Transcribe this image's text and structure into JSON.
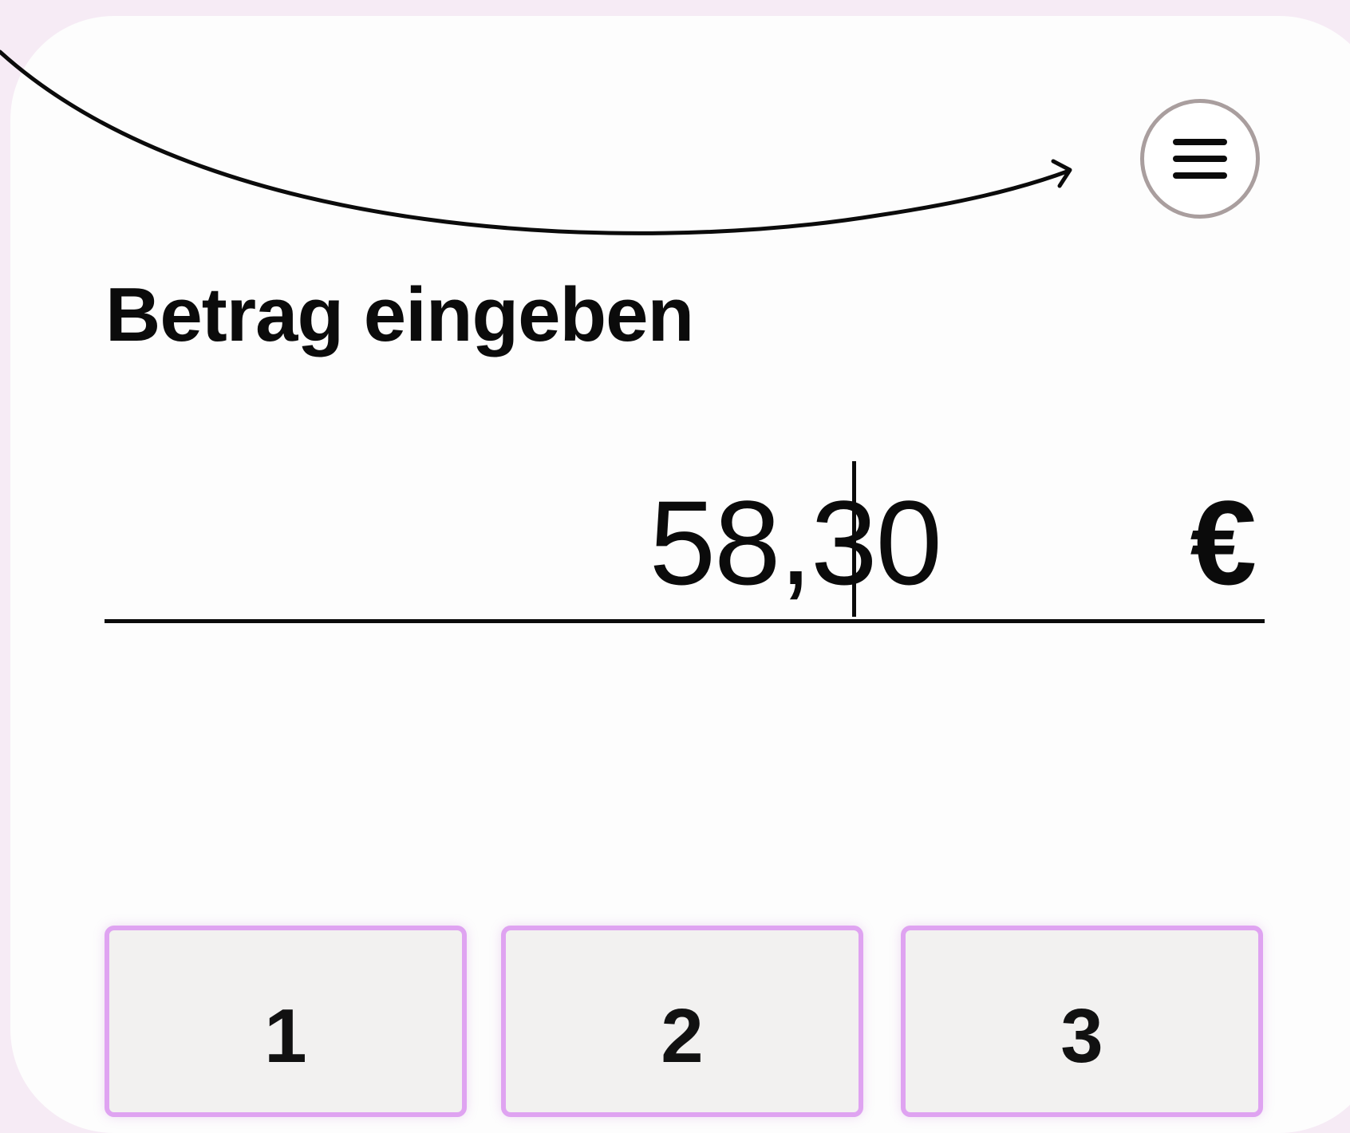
{
  "header": {
    "menu_icon": "hamburger-menu-icon",
    "arrow_icon": "curved-arrow-icon"
  },
  "amount_entry": {
    "heading": "Betrag eingeben",
    "value": "58,30",
    "currency": "€"
  },
  "keypad": {
    "keys": [
      "1",
      "2",
      "3"
    ]
  },
  "colors": {
    "page_background": "#f6ebf5",
    "card_background": "#fdfdfd",
    "key_border": "#dfa3f1",
    "key_background": "#f2f1f0",
    "menu_ring": "#a99e9e",
    "text": "#0b0b0b"
  }
}
